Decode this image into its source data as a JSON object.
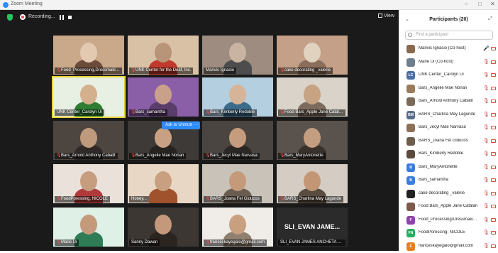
{
  "window": {
    "title": "Zoom Meeting",
    "minimize": "–",
    "maximize": "□",
    "close": "✕"
  },
  "toolbar": {
    "recording_label": "Recording...",
    "view_label": "View"
  },
  "gallery": {
    "tiles": [
      {
        "name": "Food_Processing,Dressmaking_U...",
        "muted": true
      },
      {
        "name": "UNK Center for the Deaf, Inc.",
        "muted": true
      },
      {
        "name": "Marivic Ignacio",
        "muted": false
      },
      {
        "name": "cake decorating _valerie",
        "muted": true
      },
      {
        "name": "UNK Center_Carolyn Ui",
        "muted": false
      },
      {
        "name": "Bars_samantha",
        "muted": true
      },
      {
        "name": "Bars_Kimberly Redoble",
        "muted": true
      },
      {
        "name": "Food Bars_Apple Jane Catalan",
        "muted": true
      },
      {
        "name": "Bars_Arnold Anthony Cabalit",
        "muted": true
      },
      {
        "name": "Bars_Angelie Mae Nonan",
        "muted": true
      },
      {
        "name": "Bars_Jecyl Mae Narvasa",
        "muted": true
      },
      {
        "name": "Bars_MaryAntonette",
        "muted": true
      },
      {
        "name": "FoodPoressing, NICOLE",
        "muted": true
      },
      {
        "name": "Honey...",
        "muted": false
      },
      {
        "name": "BARS_Joana Fel Giducos",
        "muted": true
      },
      {
        "name": "BARS_Charlina May Lagunde",
        "muted": true
      },
      {
        "name": "Marie Ui",
        "muted": true
      },
      {
        "name": "Sanny Dawan",
        "muted": false
      },
      {
        "name": "franceskayegalo@gmail.com",
        "muted": true
      },
      {
        "name": "SLI_EVAN JAMES ANCHETA UCNHS",
        "muted": false,
        "display": "SLI_EVAN  JAME..."
      }
    ],
    "ask_to_unmute": "Ask to Unmute",
    "more": "···"
  },
  "participants": {
    "title": "Participants (20)",
    "search_placeholder": "Find a participant",
    "items": [
      {
        "name": "Marivic Ignacio (Co-host)",
        "initials": "",
        "color": "#8a6a4f",
        "mic": "on"
      },
      {
        "name": "Marie Ui (Co-host)",
        "initials": "",
        "color": "#6d7f8f",
        "mic": "off"
      },
      {
        "name": "UNK Center_Carolyn Ui",
        "initials": "LC",
        "color": "#4a6fa5",
        "mic": "off"
      },
      {
        "name": "Bars_Angelie Mae Nonan",
        "initials": "",
        "color": "#9a7b5a",
        "mic": "off"
      },
      {
        "name": "Bars_Arnold Anthony Cabalit",
        "initials": "",
        "color": "#7a6a5a",
        "mic": "off"
      },
      {
        "name": "BARS_Charlina May Lagunde",
        "initials": "BM",
        "color": "#5a6e8a",
        "mic": "off"
      },
      {
        "name": "Bars_Jecyl Mae Narvasa",
        "initials": "",
        "color": "#8f6f58",
        "mic": "off"
      },
      {
        "name": "BARS_Joana Fel Giducos",
        "initials": "",
        "color": "#6e5d4d",
        "mic": "off"
      },
      {
        "name": "Bars_Kimberly Redoble",
        "initials": "",
        "color": "#5d4a3e",
        "mic": "off"
      },
      {
        "name": "Bars_MaryAntonette",
        "initials": "B",
        "color": "#3b7ddd",
        "mic": "off"
      },
      {
        "name": "Bars_samantha",
        "initials": "B",
        "color": "#3b7ddd",
        "mic": "off"
      },
      {
        "name": "cake decorating _valerie",
        "initials": "",
        "color": "#222222",
        "mic": "off"
      },
      {
        "name": "Food Bars_Apple Jane Catalan",
        "initials": "",
        "color": "#7d5a4a",
        "mic": "off"
      },
      {
        "name": "Food_Processing/Dressmaking_...",
        "initials": "F",
        "color": "#8e44ad",
        "mic": "off"
      },
      {
        "name": "FoodPoressing, NICOLE",
        "initials": "FN",
        "color": "#27ae60",
        "mic": "off"
      },
      {
        "name": "franceskayegalo@gmail.com",
        "initials": "F",
        "color": "#e67e22",
        "mic": "off"
      }
    ]
  },
  "colors": {
    "accent": "#2d8cff",
    "muted_red": "#e04444",
    "active_speaker": "#e6d33a"
  }
}
